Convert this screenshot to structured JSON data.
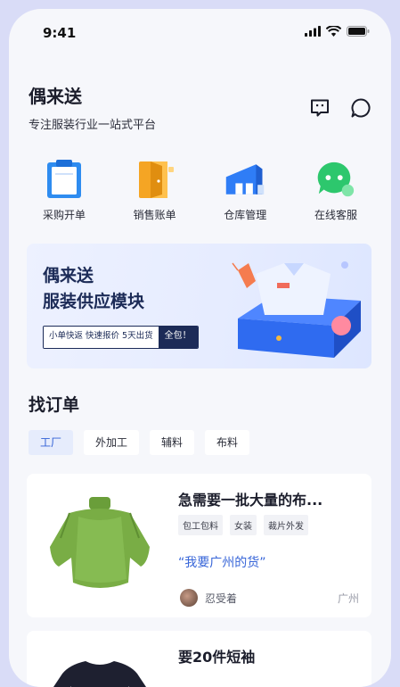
{
  "status": {
    "time": "9:41"
  },
  "brand": {
    "title": "偶来送",
    "subtitle": "专注服装行业一站式平台"
  },
  "top_icons": [
    "message-icon",
    "chat-bubble-icon"
  ],
  "quick_actions": [
    {
      "label": "采购开单",
      "icon": "clipboard-icon",
      "color": "#2e8cf0"
    },
    {
      "label": "销售账单",
      "icon": "door-icon",
      "color": "#f5a524"
    },
    {
      "label": "仓库管理",
      "icon": "warehouse-icon",
      "color": "#2f7df6"
    },
    {
      "label": "在线客服",
      "icon": "chat-icon",
      "color": "#2dc76d"
    }
  ],
  "banner": {
    "line1": "偶来送",
    "line2": "服装供应模块",
    "tagline": "小单快返  快速报价  5天出货",
    "button": "全包！"
  },
  "orders_section": {
    "title": "找订单",
    "filters": [
      "工厂",
      "外加工",
      "辅料",
      "布料"
    ],
    "active_filter": "工厂"
  },
  "orders": [
    {
      "title": "急需要一批大量的布...",
      "tags": [
        "包工包料",
        "女装",
        "裁片外发"
      ],
      "quote": "“我要广州的货”",
      "user": "忍受着",
      "location": "广州",
      "image": "green-knit-top"
    },
    {
      "title": "要20件短袖",
      "image": "black-tee"
    }
  ],
  "colors": {
    "accent": "#3160d6",
    "brand_navy": "#1c2b57",
    "page_bg": "#f6f7fb"
  }
}
